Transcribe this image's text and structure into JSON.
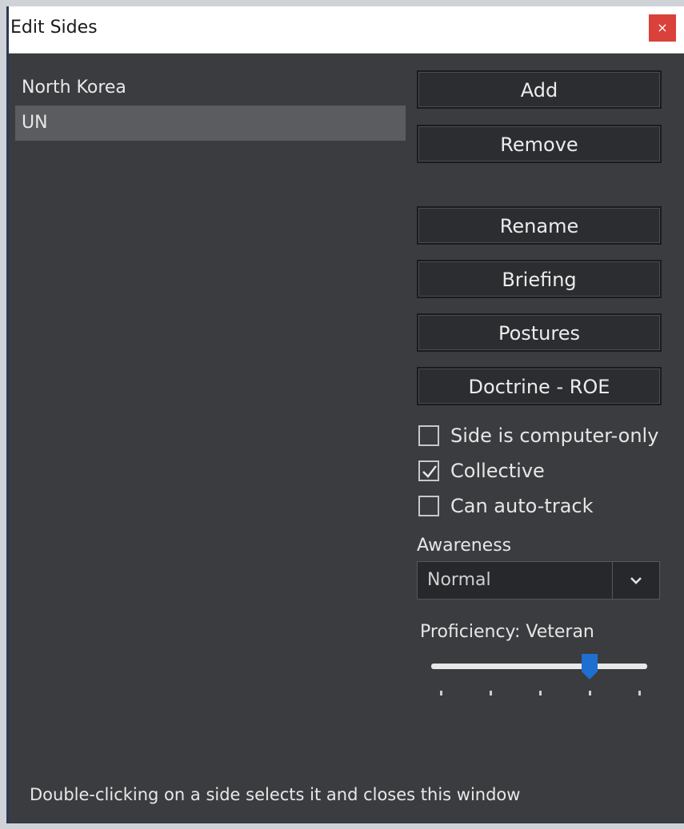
{
  "window": {
    "title": "Edit Sides",
    "close_symbol": "×"
  },
  "sides": [
    "North Korea",
    "UN"
  ],
  "selected_side": "UN",
  "buttons": {
    "add": "Add",
    "remove": "Remove",
    "rename": "Rename",
    "briefing": "Briefing",
    "postures": "Postures",
    "doctrine": "Doctrine - ROE"
  },
  "options": {
    "computer_only": {
      "label": "Side is computer-only",
      "checked": false
    },
    "collective": {
      "label": "Collective",
      "checked": true
    },
    "auto_track": {
      "label": "Can auto-track",
      "checked": false
    }
  },
  "awareness": {
    "label": "Awareness",
    "value": "Normal"
  },
  "proficiency": {
    "label": "Proficiency: Veteran",
    "level": 4,
    "max_level": 5
  },
  "footer": {
    "hint": "Double-clicking on a side selects it and closes this window"
  },
  "colors": {
    "accent": "#1f6fd0",
    "close": "#d9413a"
  },
  "icons": {
    "close": "close-icon",
    "dropdown": "chevron-down-icon",
    "check": "checkmark-icon"
  }
}
